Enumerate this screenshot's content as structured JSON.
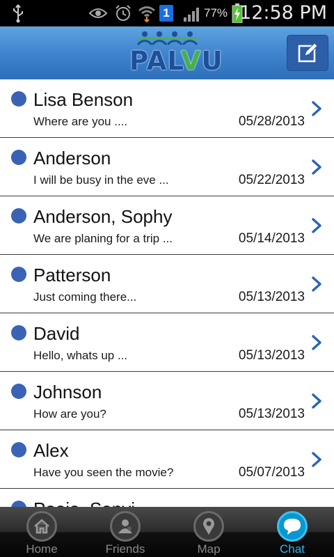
{
  "status_bar": {
    "battery_percent": "77%",
    "clock": "12:58 PM",
    "notification_badge": "1",
    "icons": [
      "usb-icon",
      "eye-icon",
      "alarm-icon",
      "wifi-icon",
      "notification-badge-icon",
      "signal-icon",
      "battery-charging-icon"
    ]
  },
  "header": {
    "logo_text_a": "PAL",
    "logo_text_b": "V",
    "logo_text_c": "U",
    "compose_icon": "compose-icon",
    "brand_color": "#3d82cc"
  },
  "chats": [
    {
      "name": "Lisa Benson",
      "preview": "Where are you ....",
      "date": "05/28/2013"
    },
    {
      "name": "Anderson",
      "preview": "I will be busy in the eve ...",
      "date": "05/22/2013"
    },
    {
      "name": "Anderson, Sophy",
      "preview": "We are planing for a trip ...",
      "date": "05/14/2013"
    },
    {
      "name": "Patterson",
      "preview": "Just coming there...",
      "date": "05/13/2013"
    },
    {
      "name": "David",
      "preview": "Hello, whats up ...",
      "date": "05/13/2013"
    },
    {
      "name": "Johnson",
      "preview": "How are you?",
      "date": "05/13/2013"
    },
    {
      "name": "Alex",
      "preview": "Have you seen the movie?",
      "date": "05/07/2013"
    },
    {
      "name": "Pooja, Sanvi",
      "preview": "",
      "date": ""
    }
  ],
  "tabs": [
    {
      "label": "Home",
      "icon": "home-icon"
    },
    {
      "label": "Friends",
      "icon": "friends-icon"
    },
    {
      "label": "Map",
      "icon": "map-pin-icon"
    },
    {
      "label": "Chat",
      "icon": "chat-bubble-icon",
      "active": true
    }
  ],
  "colors": {
    "unread_dot": "#3a63b5",
    "chevron": "#2e63b3",
    "active_tab": "#2ab6ee"
  }
}
